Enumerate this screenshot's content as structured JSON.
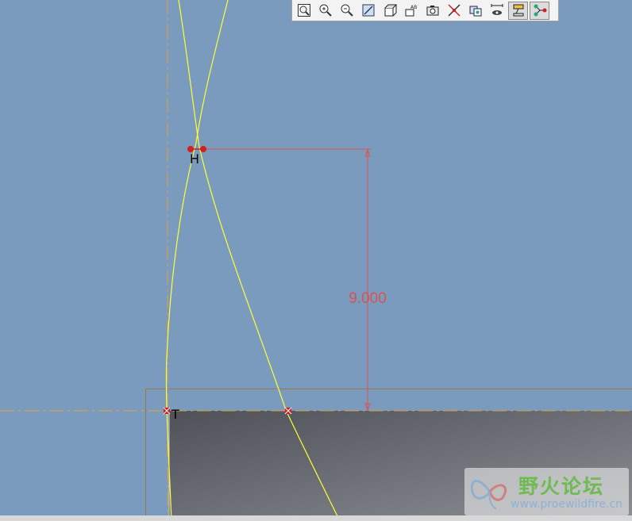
{
  "colors": {
    "background": "#7b9bbe",
    "curve": "#ffff33",
    "dimension": "#d9534f",
    "centerline": "#e0a040",
    "part_edge": "#a8703a",
    "point": "#d02020"
  },
  "toolbar": {
    "buttons": [
      {
        "icon": "refit-zoom-icon",
        "active": false
      },
      {
        "icon": "zoom-in-icon",
        "active": false
      },
      {
        "icon": "zoom-out-icon",
        "active": false
      },
      {
        "icon": "repaint-icon",
        "active": false
      },
      {
        "icon": "display-style-icon",
        "active": false
      },
      {
        "icon": "saved-views-icon",
        "active": false
      },
      {
        "icon": "camera-icon",
        "active": false
      },
      {
        "icon": "show-constraints-icon",
        "active": false
      },
      {
        "icon": "show-grid-icon",
        "active": false
      },
      {
        "icon": "show-dimensions-icon",
        "active": false
      },
      {
        "icon": "show-vertices-icon",
        "active": true
      },
      {
        "icon": "show-points-icon",
        "active": true
      }
    ]
  },
  "sketch": {
    "dimension_value": "9.000",
    "constraint_labels": {
      "horizontal": "H",
      "tangent": "T"
    }
  },
  "watermark": {
    "title": "野火论坛",
    "url": "www.proewildfire.cn"
  }
}
